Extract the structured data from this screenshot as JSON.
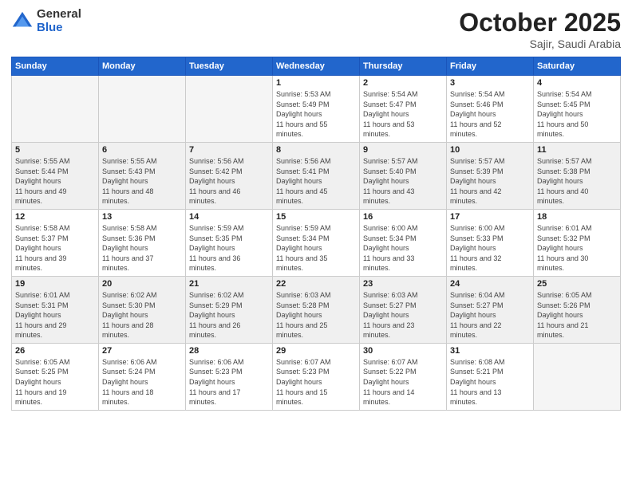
{
  "header": {
    "logo_general": "General",
    "logo_blue": "Blue",
    "month": "October 2025",
    "location": "Sajir, Saudi Arabia"
  },
  "days_of_week": [
    "Sunday",
    "Monday",
    "Tuesday",
    "Wednesday",
    "Thursday",
    "Friday",
    "Saturday"
  ],
  "weeks": [
    [
      {
        "day": "",
        "empty": true
      },
      {
        "day": "",
        "empty": true
      },
      {
        "day": "",
        "empty": true
      },
      {
        "day": "1",
        "sunrise": "5:53 AM",
        "sunset": "5:49 PM",
        "daylight": "11 hours and 55 minutes."
      },
      {
        "day": "2",
        "sunrise": "5:54 AM",
        "sunset": "5:47 PM",
        "daylight": "11 hours and 53 minutes."
      },
      {
        "day": "3",
        "sunrise": "5:54 AM",
        "sunset": "5:46 PM",
        "daylight": "11 hours and 52 minutes."
      },
      {
        "day": "4",
        "sunrise": "5:54 AM",
        "sunset": "5:45 PM",
        "daylight": "11 hours and 50 minutes."
      }
    ],
    [
      {
        "day": "5",
        "sunrise": "5:55 AM",
        "sunset": "5:44 PM",
        "daylight": "11 hours and 49 minutes."
      },
      {
        "day": "6",
        "sunrise": "5:55 AM",
        "sunset": "5:43 PM",
        "daylight": "11 hours and 48 minutes."
      },
      {
        "day": "7",
        "sunrise": "5:56 AM",
        "sunset": "5:42 PM",
        "daylight": "11 hours and 46 minutes."
      },
      {
        "day": "8",
        "sunrise": "5:56 AM",
        "sunset": "5:41 PM",
        "daylight": "11 hours and 45 minutes."
      },
      {
        "day": "9",
        "sunrise": "5:57 AM",
        "sunset": "5:40 PM",
        "daylight": "11 hours and 43 minutes."
      },
      {
        "day": "10",
        "sunrise": "5:57 AM",
        "sunset": "5:39 PM",
        "daylight": "11 hours and 42 minutes."
      },
      {
        "day": "11",
        "sunrise": "5:57 AM",
        "sunset": "5:38 PM",
        "daylight": "11 hours and 40 minutes."
      }
    ],
    [
      {
        "day": "12",
        "sunrise": "5:58 AM",
        "sunset": "5:37 PM",
        "daylight": "11 hours and 39 minutes."
      },
      {
        "day": "13",
        "sunrise": "5:58 AM",
        "sunset": "5:36 PM",
        "daylight": "11 hours and 37 minutes."
      },
      {
        "day": "14",
        "sunrise": "5:59 AM",
        "sunset": "5:35 PM",
        "daylight": "11 hours and 36 minutes."
      },
      {
        "day": "15",
        "sunrise": "5:59 AM",
        "sunset": "5:34 PM",
        "daylight": "11 hours and 35 minutes."
      },
      {
        "day": "16",
        "sunrise": "6:00 AM",
        "sunset": "5:34 PM",
        "daylight": "11 hours and 33 minutes."
      },
      {
        "day": "17",
        "sunrise": "6:00 AM",
        "sunset": "5:33 PM",
        "daylight": "11 hours and 32 minutes."
      },
      {
        "day": "18",
        "sunrise": "6:01 AM",
        "sunset": "5:32 PM",
        "daylight": "11 hours and 30 minutes."
      }
    ],
    [
      {
        "day": "19",
        "sunrise": "6:01 AM",
        "sunset": "5:31 PM",
        "daylight": "11 hours and 29 minutes."
      },
      {
        "day": "20",
        "sunrise": "6:02 AM",
        "sunset": "5:30 PM",
        "daylight": "11 hours and 28 minutes."
      },
      {
        "day": "21",
        "sunrise": "6:02 AM",
        "sunset": "5:29 PM",
        "daylight": "11 hours and 26 minutes."
      },
      {
        "day": "22",
        "sunrise": "6:03 AM",
        "sunset": "5:28 PM",
        "daylight": "11 hours and 25 minutes."
      },
      {
        "day": "23",
        "sunrise": "6:03 AM",
        "sunset": "5:27 PM",
        "daylight": "11 hours and 23 minutes."
      },
      {
        "day": "24",
        "sunrise": "6:04 AM",
        "sunset": "5:27 PM",
        "daylight": "11 hours and 22 minutes."
      },
      {
        "day": "25",
        "sunrise": "6:05 AM",
        "sunset": "5:26 PM",
        "daylight": "11 hours and 21 minutes."
      }
    ],
    [
      {
        "day": "26",
        "sunrise": "6:05 AM",
        "sunset": "5:25 PM",
        "daylight": "11 hours and 19 minutes."
      },
      {
        "day": "27",
        "sunrise": "6:06 AM",
        "sunset": "5:24 PM",
        "daylight": "11 hours and 18 minutes."
      },
      {
        "day": "28",
        "sunrise": "6:06 AM",
        "sunset": "5:23 PM",
        "daylight": "11 hours and 17 minutes."
      },
      {
        "day": "29",
        "sunrise": "6:07 AM",
        "sunset": "5:23 PM",
        "daylight": "11 hours and 15 minutes."
      },
      {
        "day": "30",
        "sunrise": "6:07 AM",
        "sunset": "5:22 PM",
        "daylight": "11 hours and 14 minutes."
      },
      {
        "day": "31",
        "sunrise": "6:08 AM",
        "sunset": "5:21 PM",
        "daylight": "11 hours and 13 minutes."
      },
      {
        "day": "",
        "empty": true
      }
    ]
  ]
}
